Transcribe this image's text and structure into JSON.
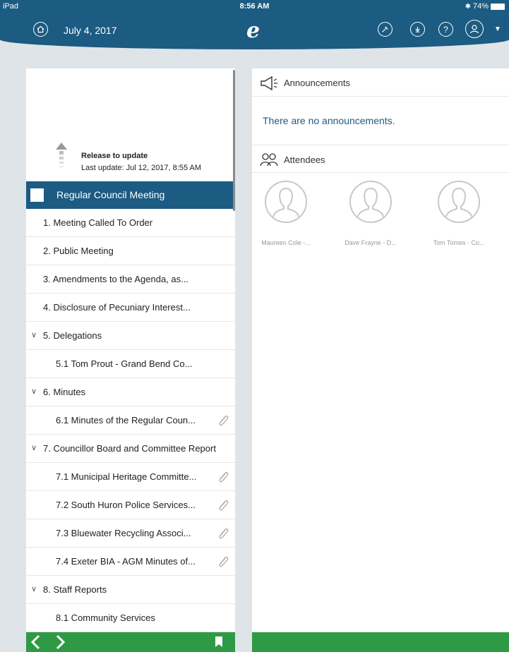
{
  "status_bar": {
    "device": "iPad",
    "time": "8:56 AM",
    "battery": "74%"
  },
  "header": {
    "date": "July 4, 2017",
    "logo": "e"
  },
  "pull_to_refresh": {
    "label": "Release to update",
    "last_update": "Last update: Jul 12, 2017, 8:55 AM"
  },
  "agenda": {
    "selected": "Regular Council Meeting",
    "items": [
      {
        "label": "1. Meeting Called To Order"
      },
      {
        "label": "2. Public Meeting"
      },
      {
        "label": "3. Amendments to the Agenda, as..."
      },
      {
        "label": "4. Disclosure of Pecuniary Interest..."
      },
      {
        "label": "5. Delegations"
      },
      {
        "label": "5.1 Tom Prout - Grand Bend Co..."
      },
      {
        "label": "6. Minutes"
      },
      {
        "label": "6.1 Minutes of the Regular Coun..."
      },
      {
        "label": "7. Councillor Board and Committee Report"
      },
      {
        "label": "7.1 Municipal Heritage Committe..."
      },
      {
        "label": "7.2 South Huron Police Services..."
      },
      {
        "label": "7.3 Bluewater Recycling Associ..."
      },
      {
        "label": "7.4 Exeter BIA - AGM Minutes of..."
      },
      {
        "label": "8. Staff Reports"
      },
      {
        "label": "8.1 Community Services"
      }
    ]
  },
  "announcements": {
    "title": "Announcements",
    "empty_text": "There are no announcements."
  },
  "attendees": {
    "title": "Attendees",
    "people": [
      {
        "name": "Maureen Cole -..."
      },
      {
        "name": "Dave Frayne - D..."
      },
      {
        "name": "Tom Tomes - Co..."
      }
    ]
  },
  "colors": {
    "header": "#1c5b82",
    "footer": "#2e9a46",
    "background": "#dfe4e8"
  },
  "icons": [
    "home-icon",
    "logo",
    "pin-icon",
    "download-icon",
    "help-icon",
    "profile-icon",
    "megaphone-icon",
    "attendees-icon",
    "paperclip-icon",
    "bookmark-icon"
  ]
}
